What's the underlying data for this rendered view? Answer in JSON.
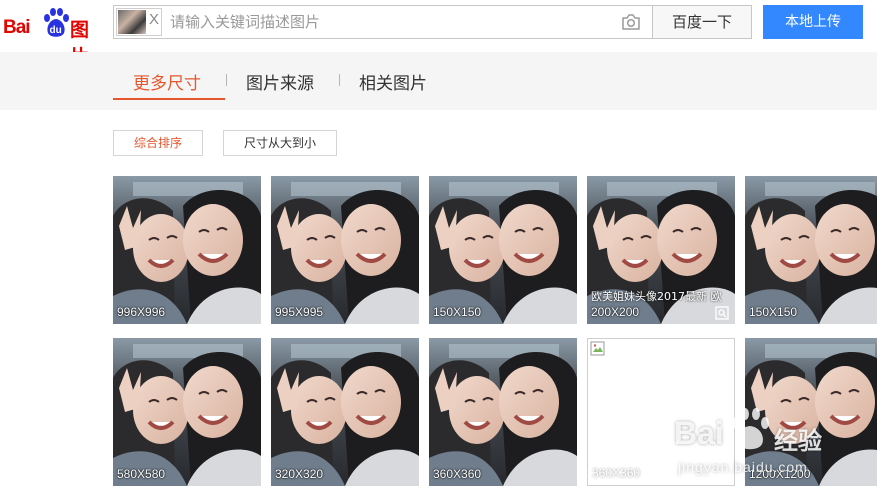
{
  "header": {
    "logo_text": "Bai",
    "logo_paw_text": "du",
    "logo_suffix": "图片",
    "thumb_close": "X",
    "search_placeholder": "请输入关键词描述图片",
    "search_button": "百度一下",
    "upload_button": "本地上传"
  },
  "tabs": [
    {
      "label": "更多尺寸",
      "active": true
    },
    {
      "label": "图片来源",
      "active": false
    },
    {
      "label": "相关图片",
      "active": false
    }
  ],
  "sort": [
    {
      "label": "综合排序",
      "active": true
    },
    {
      "label": "尺寸从大到小",
      "active": false
    }
  ],
  "results": [
    {
      "size": "996X996",
      "caption": ""
    },
    {
      "size": "995X995",
      "caption": ""
    },
    {
      "size": "150X150",
      "caption": ""
    },
    {
      "size": "200X200",
      "caption": "欧美姐妹头像2017最新 欧"
    },
    {
      "size": "150X150",
      "caption": ""
    },
    {
      "size": "580X580",
      "caption": ""
    },
    {
      "size": "320X320",
      "caption": ""
    },
    {
      "size": "360X360",
      "caption": ""
    },
    {
      "size": "360X360",
      "caption": "",
      "broken": true
    },
    {
      "size": "1200X1200",
      "caption": ""
    }
  ],
  "watermark": {
    "brand": "Bai",
    "brand_suffix": "经验",
    "url": "jingyan.baidu.com"
  },
  "colors": {
    "brand_red": "#e10601",
    "accent": "#e4572e",
    "primary_blue": "#3388ff"
  }
}
